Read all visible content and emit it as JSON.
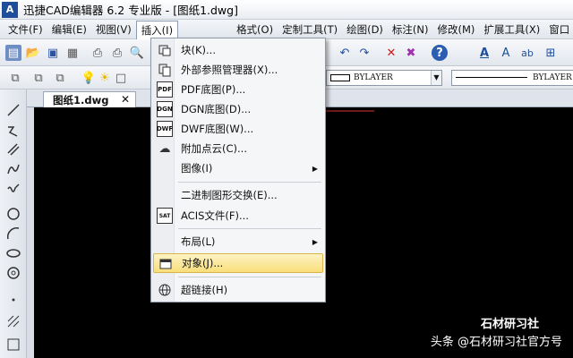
{
  "window": {
    "title": "迅捷CAD编辑器 6.2 专业版  - [图纸1.dwg]",
    "logo_text": "A"
  },
  "menubar": {
    "items": [
      "文件(F)",
      "编辑(E)",
      "视图(V)",
      "插入(I)",
      "格式(O)",
      "定制工具(T)",
      "绘图(D)",
      "标注(N)",
      "修改(M)",
      "扩展工具(X)",
      "窗口"
    ]
  },
  "toolbar2": {
    "layer_combo": "BYLAYER",
    "linetype_combo": "BYLAYER"
  },
  "doc_tabs": {
    "active_tab": "图纸1.dwg",
    "close": "✕"
  },
  "insert_menu": {
    "items": [
      {
        "label": "块(K)...",
        "icon": "block-icon",
        "glyph": "◰"
      },
      {
        "label": "外部参照管理器(X)...",
        "icon": "xref-icon",
        "glyph": "⎘"
      },
      {
        "label": "PDF底图(P)...",
        "icon": "pdf-icon",
        "glyph": "PDF"
      },
      {
        "label": "DGN底图(D)...",
        "icon": "dgn-icon",
        "glyph": "DGN"
      },
      {
        "label": "DWF底图(W)...",
        "icon": "dwf-icon",
        "glyph": "DWF"
      },
      {
        "label": "附加点云(C)...",
        "icon": "point-cloud-icon",
        "glyph": "☁"
      },
      {
        "label": "图像(I)",
        "icon": "",
        "glyph": "",
        "submenu": "▶"
      },
      {
        "label": "二进制图形交换(E)...",
        "icon": "",
        "glyph": ""
      },
      {
        "label": "ACIS文件(F)...",
        "icon": "acis-icon",
        "glyph": "SAT"
      },
      {
        "label": "布局(L)",
        "icon": "",
        "glyph": "",
        "submenu": "▶"
      },
      {
        "label": "对象(J)...",
        "icon": "ole-object-icon",
        "glyph": "▭"
      },
      {
        "label": "超链接(H)",
        "icon": "hyperlink-icon",
        "glyph": "🌐"
      }
    ]
  },
  "watermark": {
    "brand": "石材研习社",
    "account": "头条 @石材研习社官方号"
  }
}
